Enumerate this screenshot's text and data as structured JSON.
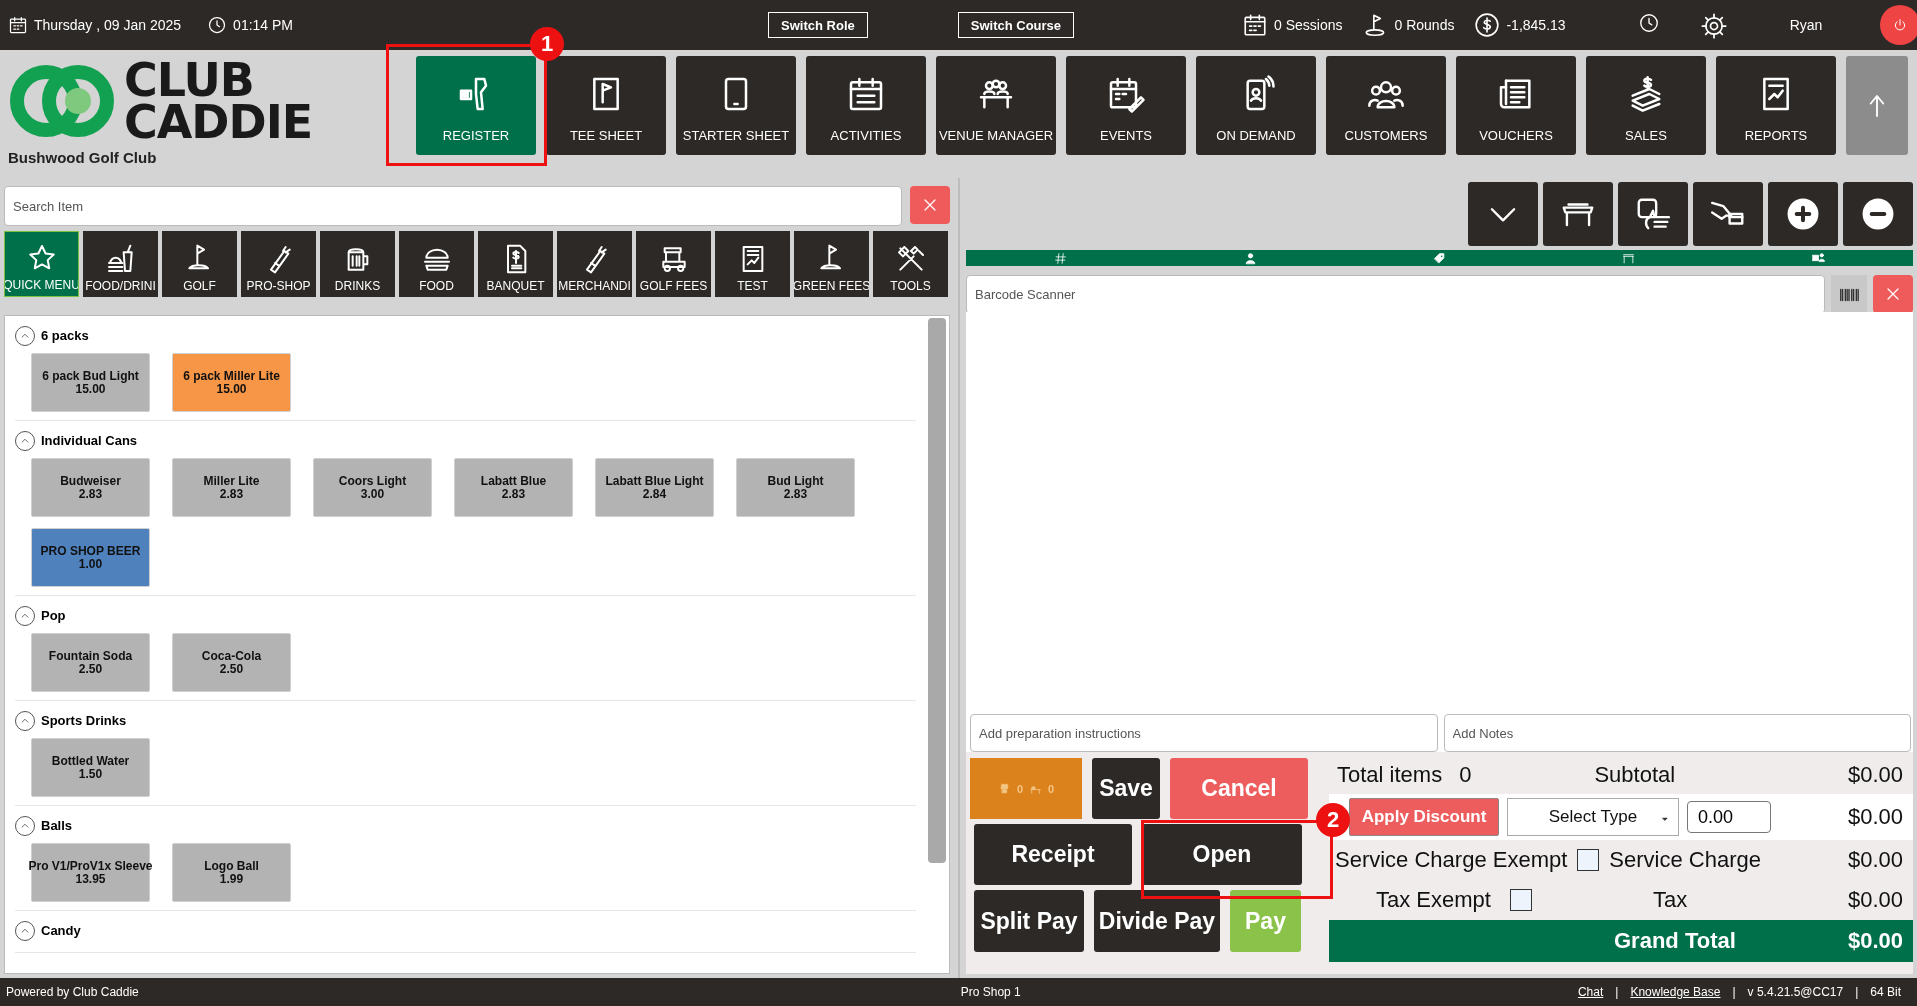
{
  "top_bar": {
    "date": "Thursday ,  09 Jan 2025",
    "time": "01:14 PM",
    "buttons": [
      "Switch Role",
      "Switch Course"
    ],
    "sessions": "0 Sessions",
    "rounds": "0 Rounds",
    "balance": "-1,845.13",
    "user": "Ryan"
  },
  "logo": {
    "line_1": "CLUB",
    "line_2": "CADDIE",
    "club_name": "Bushwood Golf Club"
  },
  "nav": [
    {
      "label": "REGISTER",
      "selected": true
    },
    {
      "label": "TEE SHEET",
      "selected": false
    },
    {
      "label": "STARTER SHEET",
      "selected": false
    },
    {
      "label": "ACTIVITIES",
      "selected": false
    },
    {
      "label": "VENUE MANAGER",
      "selected": false
    },
    {
      "label": "EVENTS",
      "selected": false
    },
    {
      "label": "ON DEMAND",
      "selected": false
    },
    {
      "label": "CUSTOMERS",
      "selected": false
    },
    {
      "label": "VOUCHERS",
      "selected": false
    },
    {
      "label": "SALES",
      "selected": false
    },
    {
      "label": "REPORTS",
      "selected": false
    }
  ],
  "search": {
    "placeholder": "Search Item"
  },
  "categories": [
    {
      "label": "QUICK MENU",
      "selected": true
    },
    {
      "label": "FOOD/DRINI",
      "selected": false
    },
    {
      "label": "GOLF",
      "selected": false
    },
    {
      "label": "PRO-SHOP",
      "selected": false
    },
    {
      "label": "DRINKS",
      "selected": false
    },
    {
      "label": "FOOD",
      "selected": false
    },
    {
      "label": "BANQUET",
      "selected": false
    },
    {
      "label": "MERCHANDI",
      "selected": false
    },
    {
      "label": "GOLF FEES",
      "selected": false
    },
    {
      "label": "TEST",
      "selected": false
    },
    {
      "label": "GREEN FEES",
      "selected": false
    },
    {
      "label": "TOOLS",
      "selected": false
    }
  ],
  "sections": [
    {
      "title": "6 packs",
      "expanded": true,
      "items": [
        {
          "name": "6 pack Bud Light",
          "price": "15.00",
          "color": "#b3b3b3"
        },
        {
          "name": "6 pack Miller Lite",
          "price": "15.00",
          "color": "#f79646"
        }
      ]
    },
    {
      "title": "Individual Cans",
      "expanded": true,
      "items": [
        {
          "name": "Budweiser",
          "price": "2.83",
          "color": "#b3b3b3"
        },
        {
          "name": "Miller Lite",
          "price": "2.83",
          "color": "#b3b3b3"
        },
        {
          "name": "Coors Light",
          "price": "3.00",
          "color": "#b3b3b3"
        },
        {
          "name": "Labatt Blue",
          "price": "2.83",
          "color": "#b3b3b3"
        },
        {
          "name": "Labatt Blue Light",
          "price": "2.84",
          "color": "#b3b3b3"
        },
        {
          "name": "Bud Light",
          "price": "2.83",
          "color": "#b3b3b3"
        },
        {
          "name": "PRO SHOP BEER",
          "price": "1.00",
          "color": "#4f81bd"
        }
      ]
    },
    {
      "title": "Pop",
      "expanded": true,
      "items": [
        {
          "name": "Fountain Soda",
          "price": "2.50",
          "color": "#b3b3b3"
        },
        {
          "name": "Coca-Cola",
          "price": "2.50",
          "color": "#b3b3b3"
        }
      ]
    },
    {
      "title": "Sports Drinks",
      "expanded": true,
      "items": [
        {
          "name": "Bottled Water",
          "price": "1.50",
          "color": "#b3b3b3"
        }
      ]
    },
    {
      "title": "Balls",
      "expanded": true,
      "items": [
        {
          "name": "Pro V1/ProV1x Sleeve",
          "price": "13.95",
          "color": "#b3b3b3"
        },
        {
          "name": "Logo Ball",
          "price": "1.99",
          "color": "#b3b3b3"
        }
      ]
    },
    {
      "title": "Candy",
      "expanded": true
    }
  ],
  "barcode": {
    "placeholder": "Barcode Scanner"
  },
  "preparation": {
    "placeholder": "Add preparation instructions"
  },
  "notes": {
    "placeholder": "Add Notes"
  },
  "counters": [
    "0",
    "0"
  ],
  "actions": [
    {
      "label": "Save",
      "kind": "dark"
    },
    {
      "label": "Cancel",
      "kind": "red"
    },
    {
      "label": "Receipt",
      "kind": "dark"
    },
    {
      "label": "Open",
      "kind": "dark"
    },
    {
      "label": "Split Pay",
      "kind": "dark"
    },
    {
      "label": "Divide Pay",
      "kind": "dark"
    },
    {
      "label": "Pay",
      "kind": "green"
    }
  ],
  "totals": {
    "items_label": "Total items",
    "items_count": "0",
    "subtotal_label": "Subtotal",
    "subtotal": "$0.00",
    "discount_button": "Apply Discount",
    "discount_type": "Select Type",
    "discount_value": "0.00",
    "discount": "$0.00",
    "service_exempt_label": "Service Charge Exempt",
    "service_exempt": false,
    "service_label": "Service Charge",
    "service": "$0.00",
    "tax_exempt_label": "Tax Exempt",
    "tax_exempt": false,
    "tax_label": "Tax",
    "tax": "$0.00",
    "grand_label": "Grand Total",
    "grand": "$0.00"
  },
  "callouts": [
    "1",
    "2"
  ],
  "footer": {
    "left": "Powered by Club Caddie",
    "center": "Pro Shop 1",
    "right": [
      {
        "kind": "link",
        "text": "Chat"
      },
      {
        "kind": "text",
        "text": "|"
      },
      {
        "kind": "link",
        "text": "Knowledge Base"
      },
      {
        "kind": "text",
        "text": "|"
      },
      {
        "kind": "text",
        "text": "v 5.4.21.5@CC17"
      },
      {
        "kind": "text",
        "text": "|"
      },
      {
        "kind": "text",
        "text": "64 Bit"
      }
    ]
  }
}
